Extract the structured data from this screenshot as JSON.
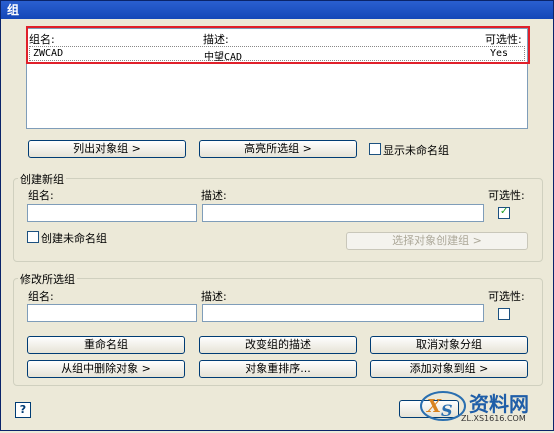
{
  "window": {
    "title": "组"
  },
  "groups_list": {
    "headers": {
      "name": "组名:",
      "description": "描述:",
      "selectable": "可选性:"
    },
    "rows": [
      {
        "name": "ZWCAD",
        "description": "中望CAD",
        "selectable": "Yes"
      }
    ]
  },
  "list_actions": {
    "list_button": "列出对象组  >",
    "highlight_button": "高亮所选组  >",
    "show_unnamed_label": "显示未命名组"
  },
  "create_group": {
    "title": "创建新组",
    "name_label": "组名:",
    "description_label": "描述:",
    "selectable_label": "可选性:",
    "name_value": "",
    "description_value": "",
    "selectable_checked": true,
    "unnamed_label": "创建未命名组",
    "select_objects_button": "选择对象创建组  >"
  },
  "modify_group": {
    "title": "修改所选组",
    "name_label": "组名:",
    "description_label": "描述:",
    "selectable_label": "可选性:",
    "name_value": "",
    "description_value": "",
    "selectable_checked": false,
    "rename_button": "重命名组",
    "change_description_button": "改变组的描述",
    "ungroup_button": "取消对象分组",
    "remove_button": "从组中删除对象  >",
    "reorder_button": "对象重排序...",
    "add_button": "添加对象到组  >"
  },
  "footer": {
    "help_glyph": "?",
    "watermark_text": "资料网",
    "watermark_url": "ZL.XS1616.COM"
  }
}
